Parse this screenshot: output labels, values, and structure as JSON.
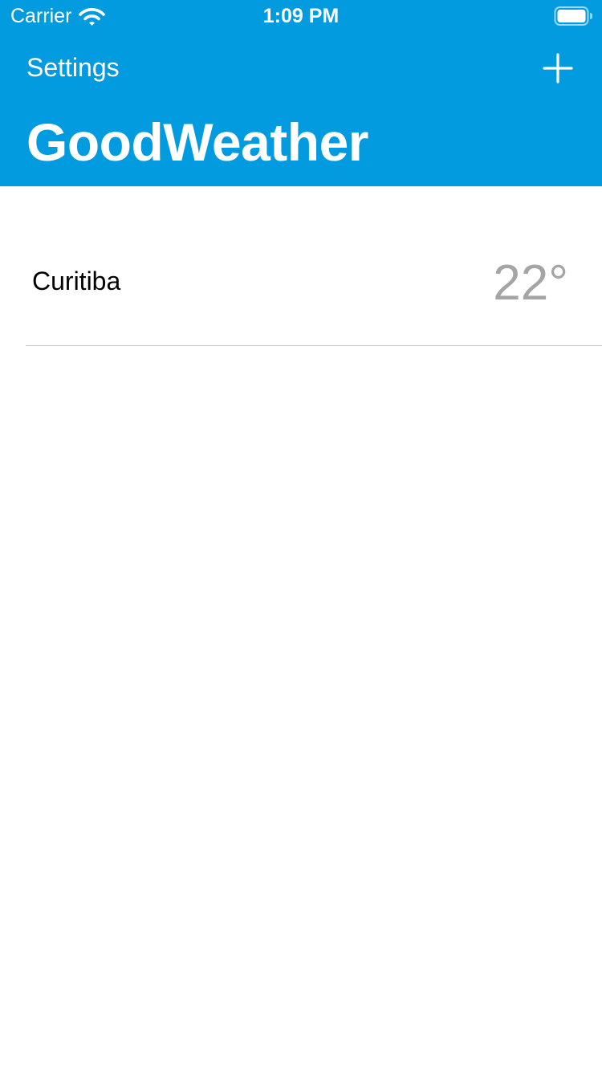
{
  "status_bar": {
    "carrier": "Carrier",
    "time": "1:09 PM",
    "wifi_icon": "wifi-icon",
    "battery_icon": "battery-icon"
  },
  "nav": {
    "left_button": "Settings",
    "right_button_icon": "plus-icon",
    "title": "GoodWeather"
  },
  "list": {
    "rows": [
      {
        "city": "Curitiba",
        "temperature": "22°"
      }
    ]
  },
  "colors": {
    "header_background": "#039be0",
    "header_text": "#ffffff",
    "temperature_text": "#a5a5a5",
    "divider": "#c8c8c8"
  }
}
